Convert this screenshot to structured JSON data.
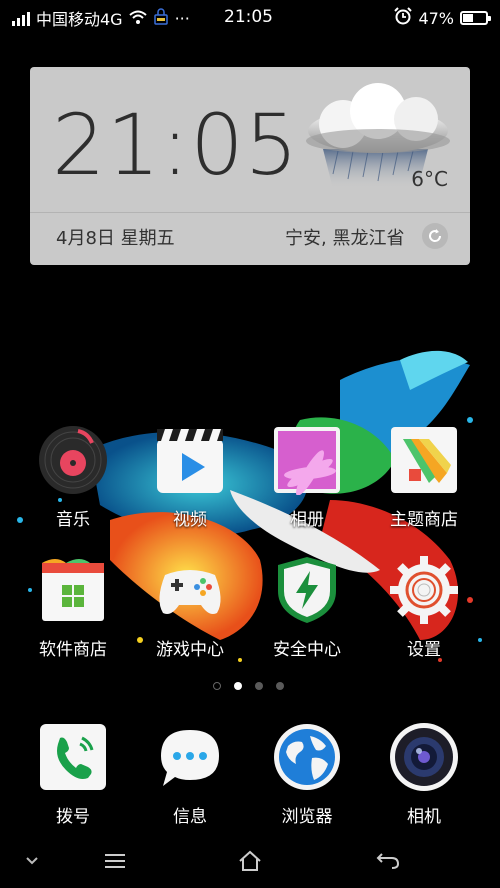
{
  "status_bar": {
    "carrier": "中国移动4G",
    "more": "···",
    "time": "21:05",
    "battery_percent": "47%",
    "battery_level": 0.47,
    "icons": [
      "signal-icon",
      "wifi-icon",
      "vpn-icon",
      "alarm-icon",
      "battery-icon"
    ]
  },
  "weather_widget": {
    "clock": "21:05",
    "temperature": "6°C",
    "date": "4月8日 星期五",
    "location": "宁安, 黑龙江省",
    "weather_icon": "cloud-rain-icon",
    "refresh_icon": "refresh-icon"
  },
  "apps": [
    {
      "label": "音乐",
      "icon": "music-icon"
    },
    {
      "label": "视频",
      "icon": "video-icon"
    },
    {
      "label": "相册",
      "icon": "gallery-icon"
    },
    {
      "label": "主题商店",
      "icon": "theme-store-icon"
    },
    {
      "label": "软件商店",
      "icon": "app-store-icon"
    },
    {
      "label": "游戏中心",
      "icon": "game-center-icon"
    },
    {
      "label": "安全中心",
      "icon": "security-center-icon"
    },
    {
      "label": "设置",
      "icon": "settings-icon"
    }
  ],
  "page_indicator": {
    "pages": 3,
    "current": 1
  },
  "dock": [
    {
      "label": "拨号",
      "icon": "phone-icon"
    },
    {
      "label": "信息",
      "icon": "messages-icon"
    },
    {
      "label": "浏览器",
      "icon": "browser-icon"
    },
    {
      "label": "相机",
      "icon": "camera-icon"
    }
  ],
  "nav_bar": {
    "icons": [
      "collapse-icon",
      "menu-icon",
      "home-icon",
      "back-icon"
    ]
  },
  "colors": {
    "widget_bg": "#c9c9c9",
    "phone_green": "#1aa14b",
    "security_green": "#1b8f3c",
    "music_red": "#e8455f"
  }
}
